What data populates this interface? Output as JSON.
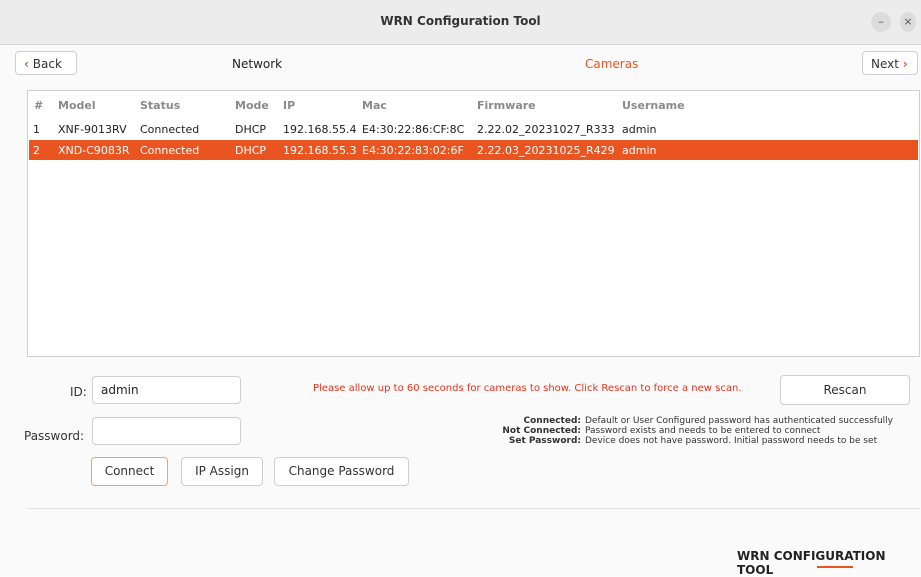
{
  "window": {
    "title": "WRN Configuration Tool",
    "minimize_glyph": "–",
    "close_glyph": "×"
  },
  "nav": {
    "back_label": "Back",
    "back_icon": "‹",
    "next_label": "Next",
    "next_icon": "›",
    "step1": "Network",
    "step2": "Cameras"
  },
  "table": {
    "headers": [
      "#",
      "Model",
      "Status",
      "Mode",
      "IP",
      "Mac",
      "Firmware",
      "Username"
    ],
    "rows": [
      {
        "num": "1",
        "model": "XNF-9013RV",
        "status": "Connected",
        "mode": "DHCP",
        "ip": "192.168.55.4",
        "mac": "E4:30:22:86:CF:8C",
        "firmware": "2.22.02_20231027_R333",
        "username": "admin"
      },
      {
        "num": "2",
        "model": "XND-C9083R",
        "status": "Connected",
        "mode": "DHCP",
        "ip": "192.168.55.3",
        "mac": "E4:30:22:83:02:6F",
        "firmware": "2.22.03_20231025_R429",
        "username": "admin"
      }
    ]
  },
  "form": {
    "id_label": "ID:",
    "id_value": "admin",
    "password_label": "Password:",
    "password_value": ""
  },
  "buttons": {
    "connect": "Connect",
    "ip_assign": "IP Assign",
    "change_password": "Change Password",
    "rescan": "Rescan"
  },
  "notice": "Please allow up to 60 seconds for cameras to show. Click Rescan to force a new scan.",
  "legend": [
    {
      "key": "Connected:",
      "text": "Default or User Configured password has authenticated successfully"
    },
    {
      "key": "Not Connected:",
      "text": "Password exists and needs to be entered to connect"
    },
    {
      "key": "Set Password:",
      "text": "Device does not have password. Initial password needs to be set"
    }
  ],
  "footer": {
    "brand_strong": "WRN",
    "brand_rest": " CONFIGURATION TOOL"
  },
  "colors": {
    "accent": "#e95420",
    "notice": "#e8321a"
  }
}
